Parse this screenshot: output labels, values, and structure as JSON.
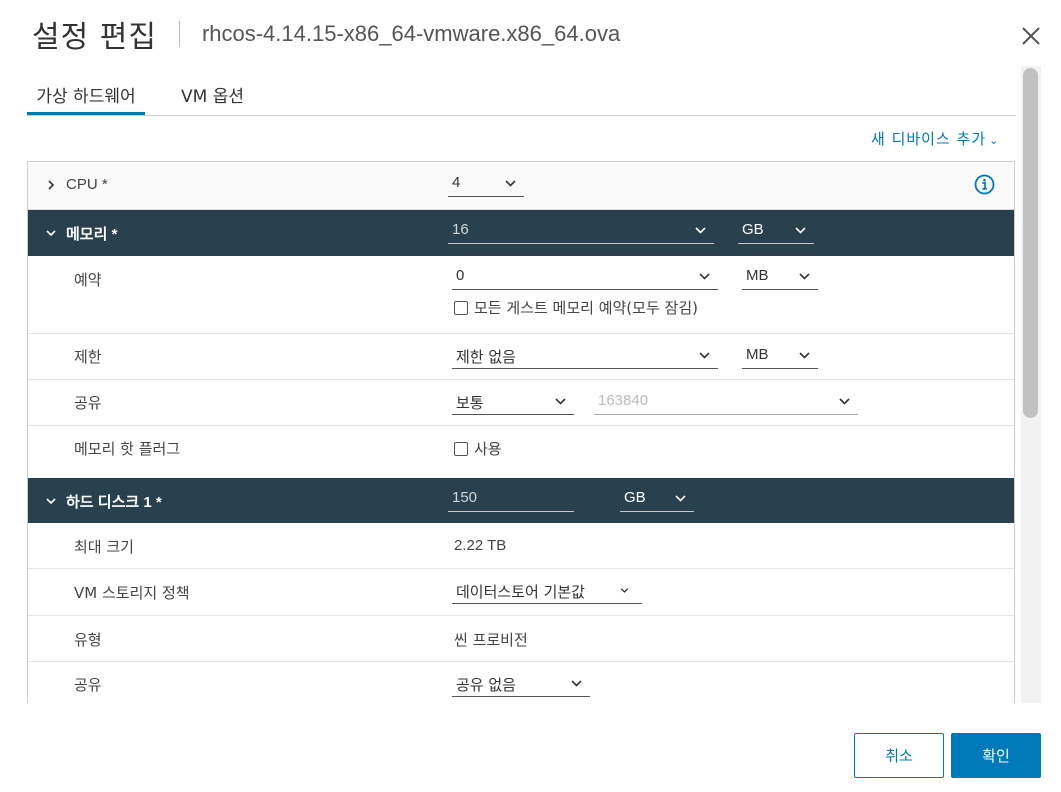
{
  "dialog": {
    "title": "설정 편집",
    "subtitle": "rhcos-4.14.15-x86_64-vmware.x86_64.ova"
  },
  "tabs": [
    {
      "label": "가상 하드웨어",
      "active": true
    },
    {
      "label": "VM 옵션",
      "active": false
    }
  ],
  "add_device": {
    "label": "새 디바이스 추가"
  },
  "cpu": {
    "label": "CPU *",
    "value": "4"
  },
  "memory": {
    "label": "메모리 *",
    "value": "16",
    "unit": "GB",
    "reservation": {
      "label": "예약",
      "value": "0",
      "unit": "MB",
      "checkbox_label": "모든 게스트 메모리 예약(모두 잠김)",
      "checked": false
    },
    "limit": {
      "label": "제한",
      "value": "제한 없음",
      "unit": "MB"
    },
    "shares": {
      "label": "공유",
      "value": "보통",
      "amount": "163840"
    },
    "hot_plug": {
      "label": "메모리 핫 플러그",
      "checkbox_label": "사용",
      "checked": false
    }
  },
  "hard_disk": {
    "label": "하드 디스크 1 *",
    "value": "150",
    "unit": "GB",
    "max_size": {
      "label": "최대 크기",
      "value": "2.22 TB"
    },
    "storage_policy": {
      "label": "VM 스토리지 정책",
      "value": "데이터스토어 기본값"
    },
    "type": {
      "label": "유형",
      "value": "씬 프로비전"
    },
    "sharing": {
      "label": "공유",
      "value": "공유 없음"
    }
  },
  "footer": {
    "cancel_label": "취소",
    "ok_label": "확인"
  },
  "colors": {
    "accent": "#0079b8",
    "section_header_bg": "#29414e"
  }
}
